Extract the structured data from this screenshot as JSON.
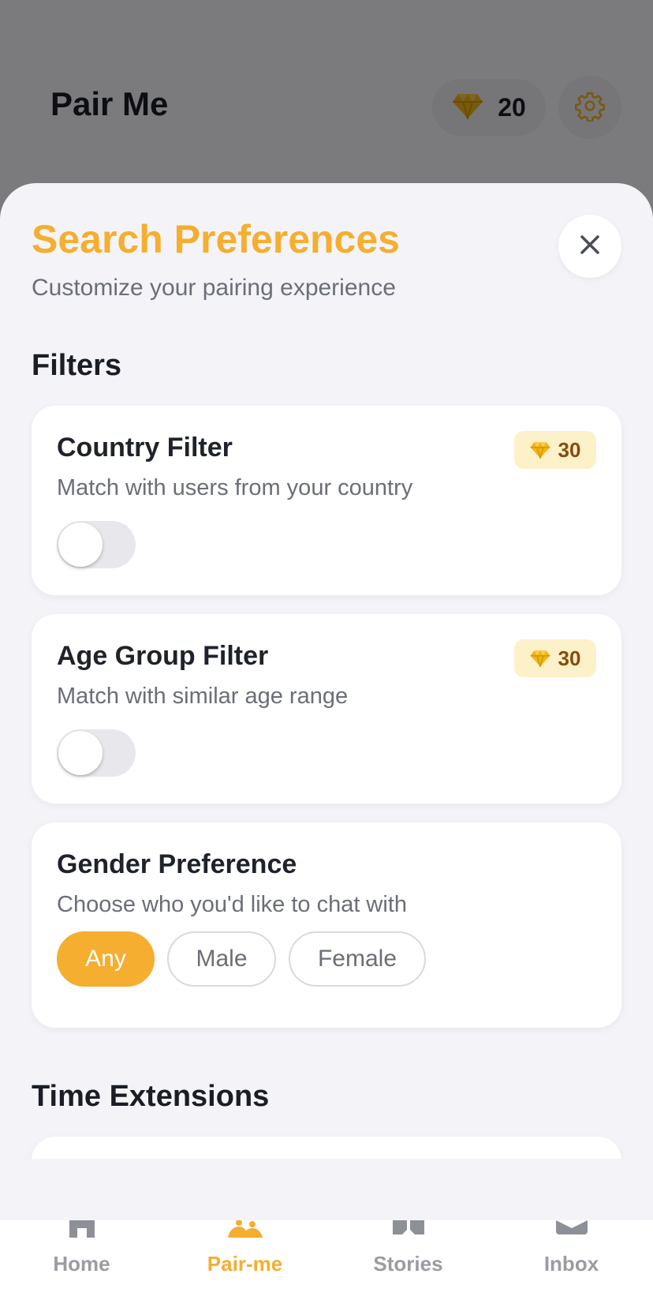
{
  "app": {
    "title": "Pair Me",
    "gem_balance": "20",
    "accent_color": "#f5ae2f"
  },
  "sheet": {
    "title": "Search Preferences",
    "subtitle": "Customize your pairing experience",
    "filters_heading": "Filters",
    "time_extensions_heading": "Time Extensions"
  },
  "cards": {
    "country": {
      "title": "Country Filter",
      "description": "Match with users from your country",
      "cost": "30",
      "enabled": false
    },
    "age": {
      "title": "Age Group Filter",
      "description": "Match with similar age range",
      "cost": "30",
      "enabled": false
    },
    "gender": {
      "title": "Gender Preference",
      "description": "Choose who you'd like to chat with",
      "options": [
        "Any",
        "Male",
        "Female"
      ],
      "selected": "Any"
    }
  },
  "bottom_nav": {
    "items": [
      {
        "label": "Home",
        "icon": "home-icon"
      },
      {
        "label": "Pair-me",
        "icon": "pair-icon",
        "active": true
      },
      {
        "label": "Stories",
        "icon": "book-icon"
      },
      {
        "label": "Inbox",
        "icon": "inbox-icon"
      }
    ]
  }
}
